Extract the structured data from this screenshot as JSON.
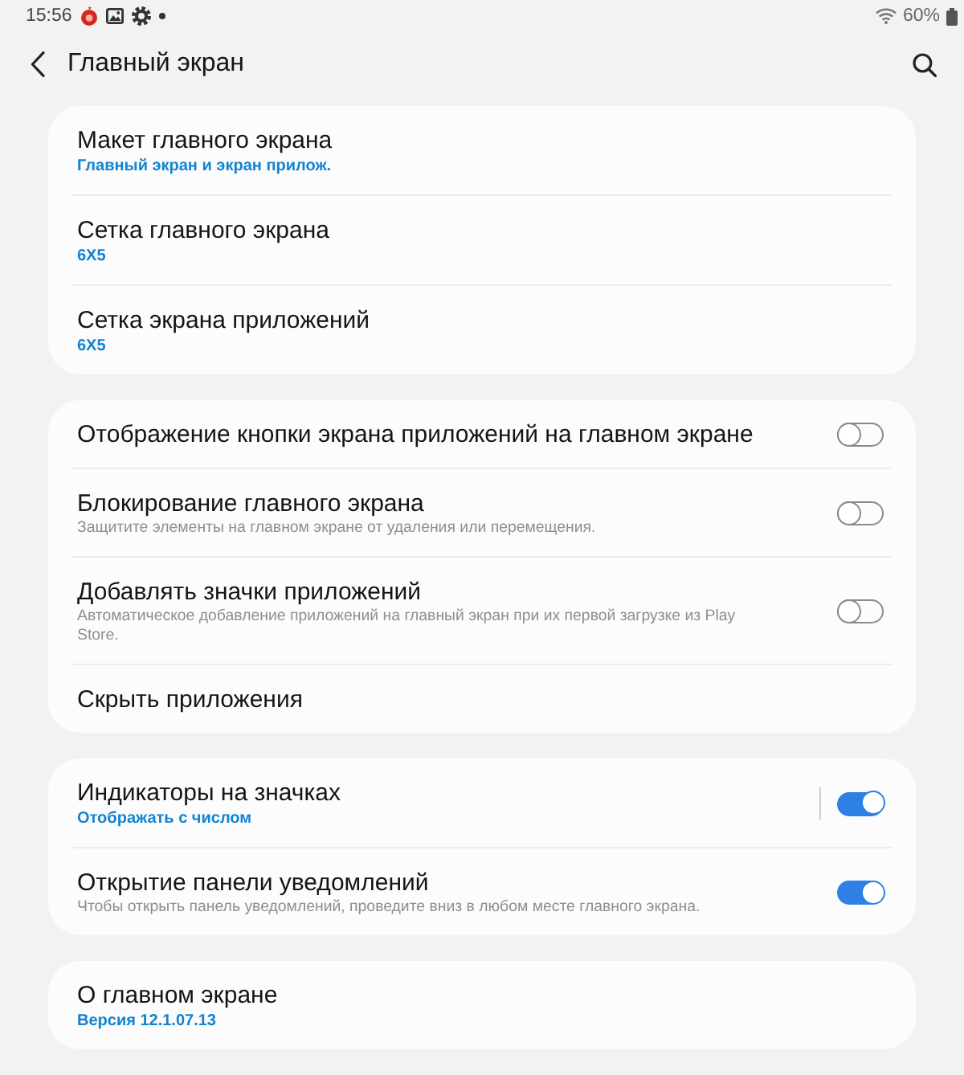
{
  "status_bar": {
    "time": "15:56",
    "battery": "60%"
  },
  "header": {
    "title": "Главный экран"
  },
  "groups": [
    {
      "items": [
        {
          "kind": "link",
          "title": "Макет главного экрана",
          "value": "Главный экран и экран прилож."
        },
        {
          "kind": "link",
          "title": "Сетка главного экрана",
          "value": "6X5"
        },
        {
          "kind": "link",
          "title": "Сетка экрана приложений",
          "value": "6X5"
        }
      ]
    },
    {
      "items": [
        {
          "kind": "toggle",
          "title": "Отображение кнопки экрана приложений на главном экране",
          "on": false,
          "split": false
        },
        {
          "kind": "toggle",
          "title": "Блокирование главного экрана",
          "description": "Защитите элементы на главном экране от удаления или перемещения.",
          "on": false,
          "split": false
        },
        {
          "kind": "toggle",
          "title": "Добавлять значки приложений",
          "description": "Автоматическое добавление приложений на главный экран при их первой загрузке из Play Store.",
          "on": false,
          "split": false
        },
        {
          "kind": "link",
          "title": "Скрыть приложения"
        }
      ]
    },
    {
      "items": [
        {
          "kind": "toggle",
          "title": "Индикаторы на значках",
          "value": "Отображать с числом",
          "on": true,
          "split": true
        },
        {
          "kind": "toggle",
          "title": "Открытие панели уведомлений",
          "description": "Чтобы открыть панель уведомлений, проведите вниз в любом месте главного экрана.",
          "on": true,
          "split": false
        }
      ]
    },
    {
      "items": [
        {
          "kind": "link",
          "title": "О главном экране",
          "value": "Версия 12.1.07.13"
        }
      ]
    }
  ]
}
